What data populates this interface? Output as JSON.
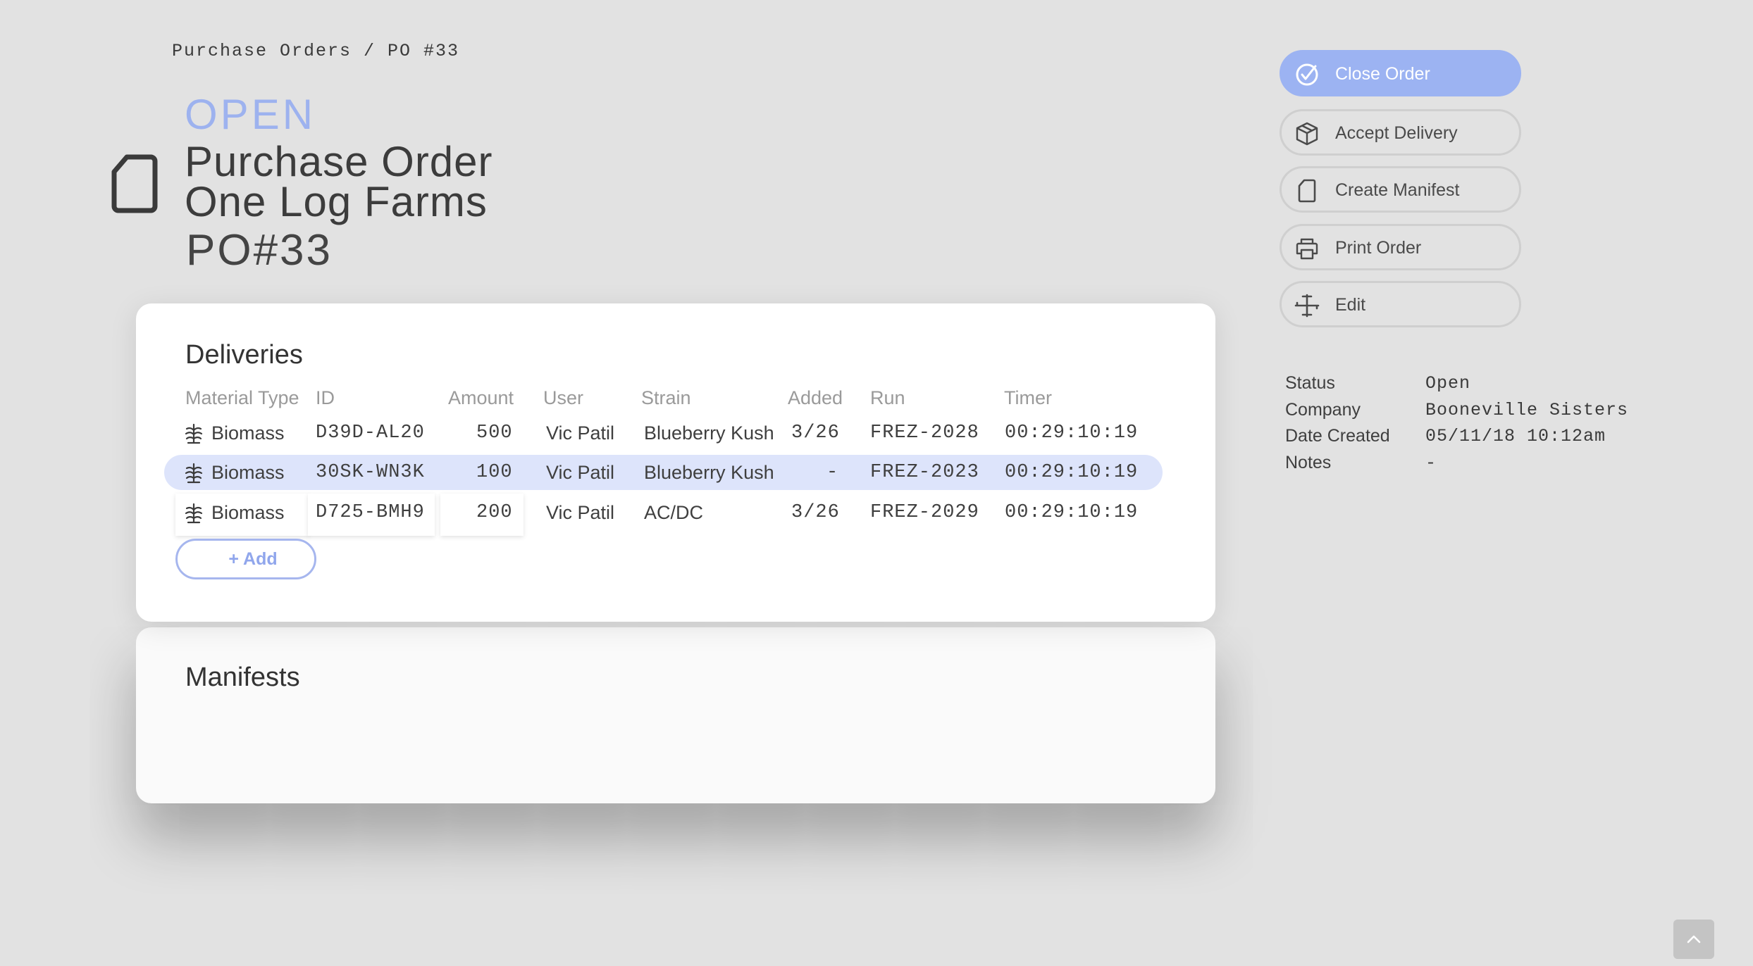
{
  "breadcrumb": "Purchase Orders / PO #33",
  "header": {
    "status": "OPEN",
    "title_line1": "Purchase Order",
    "title_line2": "One Log Farms",
    "po_number": "PO#33"
  },
  "deliveries": {
    "title": "Deliveries",
    "columns": [
      "Material Type",
      "ID",
      "Amount",
      "User",
      "Strain",
      "Added",
      "Run",
      "Timer"
    ],
    "rows": [
      {
        "material": "Biomass",
        "id": "D39D-AL20",
        "amount": "500",
        "user": "Vic Patil",
        "strain": "Blueberry Kush",
        "added": "3/26",
        "run": "FREZ-2028",
        "timer": "00:29:10:19"
      },
      {
        "material": "Biomass",
        "id": "30SK-WN3K",
        "amount": "100",
        "user": "Vic Patil",
        "strain": "Blueberry Kush",
        "added": "-",
        "run": "FREZ-2023",
        "timer": "00:29:10:19"
      },
      {
        "material": "Biomass",
        "id": "D725-BMH9",
        "amount": "200",
        "user": "Vic Patil",
        "strain": "AC/DC",
        "added": "3/26",
        "run": "FREZ-2029",
        "timer": "00:29:10:19"
      }
    ],
    "add_label": "+ Add"
  },
  "manifests": {
    "title": "Manifests"
  },
  "actions": {
    "close_order": "Close Order",
    "accept_delivery": "Accept Delivery",
    "create_manifest": "Create Manifest",
    "print_order": "Print Order",
    "edit": "Edit"
  },
  "details": {
    "status_label": "Status",
    "status_value": "Open",
    "company_label": "Company",
    "company_value": "Booneville Sisters",
    "date_label": "Date Created",
    "date_value": "05/11/18 10:12am",
    "notes_label": "Notes",
    "notes_value": "-"
  },
  "colors": {
    "accent": "#9cb3f2",
    "status_open": "#9db2ef",
    "row_highlight": "#dde4fb",
    "background": "#e2e2e2"
  },
  "icons": {
    "doc": "document-icon",
    "plant": "plant-icon",
    "check": "check-circle-icon",
    "box": "package-icon",
    "printer": "printer-icon",
    "edit": "edit-icon",
    "scroll": "chevron-up-icon"
  }
}
